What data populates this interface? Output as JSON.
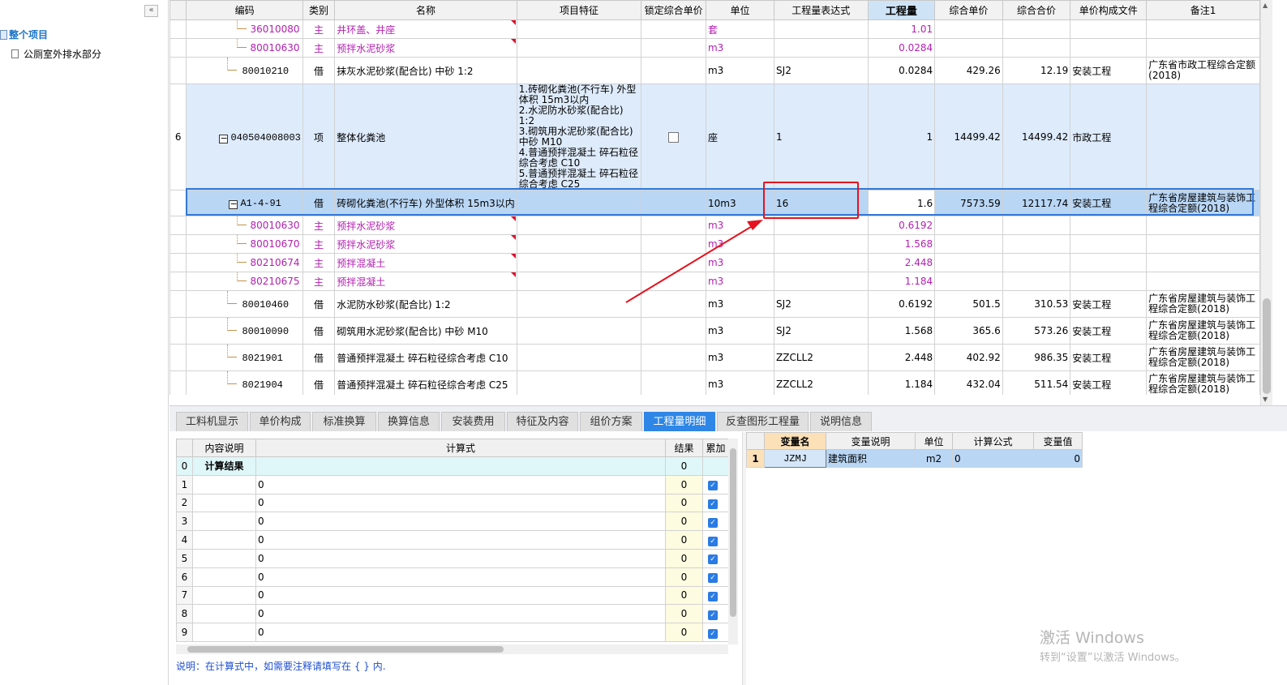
{
  "sidebar": {
    "collapse_label": "«",
    "root": "整个项目",
    "child": "公厕室外排水部分"
  },
  "grid": {
    "columns": [
      "编码",
      "类别",
      "名称",
      "项目特征",
      "锁定综合单价",
      "单位",
      "工程量表达式",
      "工程量",
      "综合单价",
      "综合合价",
      "单价构成文件",
      "备注1"
    ],
    "rows": [
      {
        "rn": "",
        "code": "36010080",
        "type": "主",
        "name": "井环盖、井座",
        "unit": "套",
        "qty": "1.01"
      },
      {
        "rn": "",
        "code": "80010630",
        "type": "主",
        "name": "预拌水泥砂浆",
        "unit": "m3",
        "qty": "0.0284"
      },
      {
        "rn": "",
        "code": "80010210",
        "type": "借",
        "name": "抹灰水泥砂浆(配合比) 中砂 1:2",
        "unit": "m3",
        "expr": "SJ2",
        "qty": "0.0284",
        "price": "429.26",
        "total": "12.19",
        "file": "安装工程",
        "note": "广东省市政工程综合定额(2018)"
      },
      {
        "rn": "6",
        "code": "040504008003",
        "type": "项",
        "name": "整体化粪池",
        "feature": "1.砖砌化粪池(不行车) 外型体积 15m3以内\n2.水泥防水砂浆(配合比) 1:2\n3.砌筑用水泥砂浆(配合比) 中砂 M10\n4.普通预拌混凝土 碎石粒径综合考虑 C10\n5.普通预拌混凝土 碎石粒径综合考虑 C25",
        "unit": "座",
        "expr": "1",
        "qty": "1",
        "price": "14499.42",
        "total": "14499.42",
        "file": "市政工程",
        "note": ""
      },
      {
        "rn": "",
        "code": "A1-4-91",
        "type": "借",
        "name": "砖砌化粪池(不行车) 外型体积 15m3以内",
        "unit": "10m3",
        "expr": "16",
        "qty": "1.6",
        "price": "7573.59",
        "total": "12117.74",
        "file": "安装工程",
        "note": "广东省房屋建筑与装饰工程综合定额(2018)"
      },
      {
        "rn": "",
        "code": "80010630",
        "type": "主",
        "name": "预拌水泥砂浆",
        "unit": "m3",
        "qty": "0.6192"
      },
      {
        "rn": "",
        "code": "80010670",
        "type": "主",
        "name": "预拌水泥砂浆",
        "unit": "m3",
        "qty": "1.568"
      },
      {
        "rn": "",
        "code": "80210674",
        "type": "主",
        "name": "预拌混凝土",
        "unit": "m3",
        "qty": "2.448"
      },
      {
        "rn": "",
        "code": "80210675",
        "type": "主",
        "name": "预拌混凝土",
        "unit": "m3",
        "qty": "1.184"
      },
      {
        "rn": "",
        "code": "80010460",
        "type": "借",
        "name": "水泥防水砂浆(配合比) 1:2",
        "unit": "m3",
        "expr": "SJ2",
        "qty": "0.6192",
        "price": "501.5",
        "total": "310.53",
        "file": "安装工程",
        "note": "广东省房屋建筑与装饰工程综合定额(2018)"
      },
      {
        "rn": "",
        "code": "80010090",
        "type": "借",
        "name": "砌筑用水泥砂浆(配合比) 中砂 M10",
        "unit": "m3",
        "expr": "SJ2",
        "qty": "1.568",
        "price": "365.6",
        "total": "573.26",
        "file": "安装工程",
        "note": "广东省房屋建筑与装饰工程综合定额(2018)"
      },
      {
        "rn": "",
        "code": "8021901",
        "type": "借",
        "name": "普通预拌混凝土 碎石粒径综合考虑 C10",
        "unit": "m3",
        "expr": "ZZCLL2",
        "qty": "2.448",
        "price": "402.92",
        "total": "986.35",
        "file": "安装工程",
        "note": "广东省房屋建筑与装饰工程综合定额(2018)"
      },
      {
        "rn": "",
        "code": "8021904",
        "type": "借",
        "name": "普通预拌混凝土 碎石粒径综合考虑 C25",
        "unit": "m3",
        "expr": "ZZCLL2",
        "qty": "1.184",
        "price": "432.04",
        "total": "511.54",
        "file": "安装工程",
        "note": "广东省房屋建筑与装饰工程综合定额(2018)"
      }
    ]
  },
  "tabs": [
    "工料机显示",
    "单价构成",
    "标准换算",
    "换算信息",
    "安装费用",
    "特征及内容",
    "组价方案",
    "工程量明细",
    "反查图形工程量",
    "说明信息"
  ],
  "active_tab": "工程量明细",
  "calc": {
    "columns": [
      "",
      "内容说明",
      "计算式",
      "结果",
      "累加"
    ],
    "result_label": "计算结果",
    "rows": [
      {
        "rn": "0",
        "desc": "计算结果",
        "formula": "",
        "result": "0"
      },
      {
        "rn": "1",
        "desc": "",
        "formula": "0",
        "result": "0"
      },
      {
        "rn": "2",
        "desc": "",
        "formula": "0",
        "result": "0"
      },
      {
        "rn": "3",
        "desc": "",
        "formula": "0",
        "result": "0"
      },
      {
        "rn": "4",
        "desc": "",
        "formula": "0",
        "result": "0"
      },
      {
        "rn": "5",
        "desc": "",
        "formula": "0",
        "result": "0"
      },
      {
        "rn": "6",
        "desc": "",
        "formula": "0",
        "result": "0"
      },
      {
        "rn": "7",
        "desc": "",
        "formula": "0",
        "result": "0"
      },
      {
        "rn": "8",
        "desc": "",
        "formula": "0",
        "result": "0"
      },
      {
        "rn": "9",
        "desc": "",
        "formula": "0",
        "result": "0"
      }
    ],
    "note": "说明：在计算式中，如需要注释请填写在 { } 内."
  },
  "vars": {
    "columns": [
      "",
      "变量名",
      "变量说明",
      "单位",
      "计算公式",
      "变量值"
    ],
    "rows": [
      {
        "rn": "1",
        "name": "JZMJ",
        "desc": "建筑面积",
        "unit": "m2",
        "formula": "0",
        "value": "0"
      }
    ]
  },
  "watermark": {
    "line1": "激活 Windows",
    "line2": "转到“设置”以激活 Windows。"
  },
  "colors": {
    "accent": "#2e86e6",
    "highlight": "#e5121f",
    "sub_row_text": "#b31fb1"
  }
}
